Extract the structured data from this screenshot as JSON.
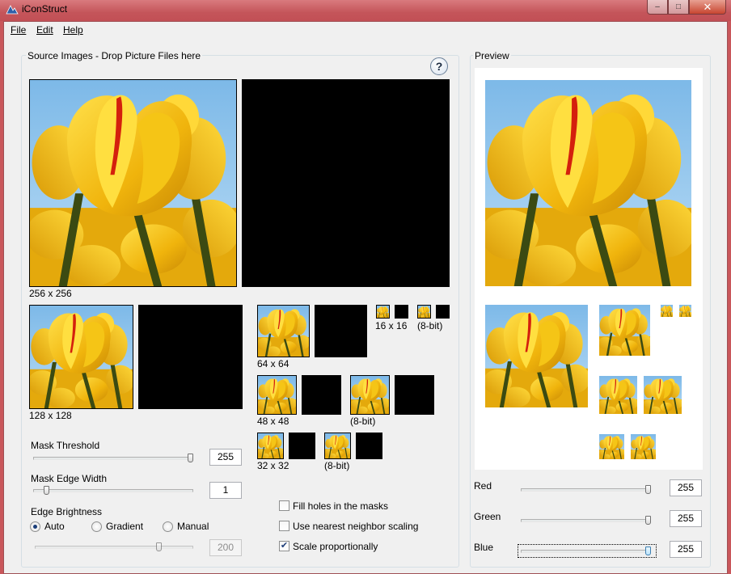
{
  "window": {
    "title": "iConStruct",
    "minimize_glyph": "–",
    "maximize_glyph": "□",
    "close_glyph": "✕"
  },
  "menu": {
    "file": "File",
    "edit": "Edit",
    "help": "Help"
  },
  "source": {
    "group_label": "Source Images - Drop Picture Files here",
    "help_glyph": "?",
    "sizes": {
      "s256": "256 x 256",
      "s128": "128 x 128",
      "s64": "64 x 64",
      "s48": "48 x 48",
      "s32": "32 x 32",
      "s16": "16 x 16",
      "bit8_16": "(8-bit)",
      "bit8_48": "(8-bit)",
      "bit8_32": "(8-bit)"
    }
  },
  "mask": {
    "threshold_label": "Mask Threshold",
    "threshold_value": "255",
    "edge_width_label": "Mask Edge Width",
    "edge_width_value": "1",
    "edge_brightness_label": "Edge Brightness",
    "radio_auto": "Auto",
    "radio_gradient": "Gradient",
    "radio_manual": "Manual",
    "selected_brightness_mode": "Auto",
    "manual_value": "200"
  },
  "options": {
    "fill_holes": "Fill holes in the masks",
    "fill_holes_checked": false,
    "nearest_neighbor": "Use nearest neighbor scaling",
    "nearest_neighbor_checked": false,
    "scale_prop": "Scale proportionally",
    "scale_prop_checked": true,
    "check_glyph": "✔"
  },
  "preview": {
    "group_label": "Preview",
    "red_label": "Red",
    "red_value": "255",
    "green_label": "Green",
    "green_value": "255",
    "blue_label": "Blue",
    "blue_value": "255"
  },
  "colors": {
    "titlebar": "#c9575b",
    "window_bg": "#f0f0f0",
    "tulip_yellow": "#f2c21a",
    "sky_blue": "#8cc4ec"
  }
}
